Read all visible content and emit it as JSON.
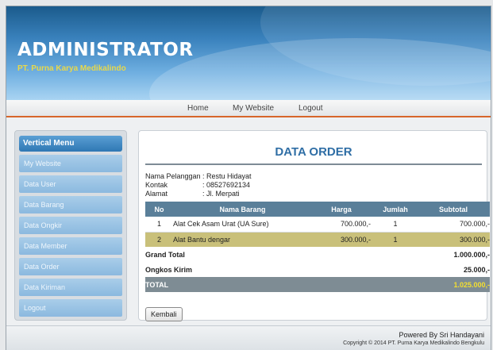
{
  "header": {
    "title": "ADMINISTRATOR",
    "subtitle": "PT. Purna Karya Medikalindo"
  },
  "topnav": {
    "home": "Home",
    "website": "My Website",
    "logout": "Logout"
  },
  "sidebar": {
    "title": "Vertical Menu",
    "items": [
      {
        "label": "My Website"
      },
      {
        "label": "Data User"
      },
      {
        "label": "Data Barang"
      },
      {
        "label": "Data Ongkir"
      },
      {
        "label": "Data Member"
      },
      {
        "label": "Data Order"
      },
      {
        "label": "Data Kiriman"
      },
      {
        "label": "Logout"
      }
    ]
  },
  "main": {
    "title": "DATA ORDER",
    "customer": {
      "name_label": "Nama Pelanggan",
      "name_value": ": Restu Hidayat",
      "contact_label": "Kontak",
      "contact_value": ": 08527692134",
      "address_label": "Alamat",
      "address_value": ": Jl. Merpati"
    },
    "table": {
      "headers": [
        "No",
        "Nama Barang",
        "Harga",
        "Jumlah",
        "Subtotal"
      ],
      "rows": [
        {
          "no": "1",
          "name": "Alat Cek Asam Urat (UA Sure)",
          "price": "700.000,-",
          "qty": "1",
          "subtotal": "700.000,-"
        },
        {
          "no": "2",
          "name": "Alat Bantu dengar",
          "price": "300.000,-",
          "qty": "1",
          "subtotal": "300.000,-"
        }
      ],
      "grand_total_label": "Grand Total",
      "grand_total_value": "1.000.000,-",
      "shipping_label": "Ongkos Kirim",
      "shipping_value": "25.000,-",
      "total_label": "TOTAL",
      "total_value": "1.025.000,-"
    },
    "back_button": "Kembali"
  },
  "footer": {
    "powered": "Powered By Sri Handayani",
    "copyright": "Copyright © 2014 PT. Purna Karya Medikalindo Bengkulu"
  },
  "colors": {
    "accent": "#2f6ea5",
    "nav_underline": "#d7662a",
    "highlight_row": "#c9c07a",
    "total_value": "#f4df2f"
  }
}
